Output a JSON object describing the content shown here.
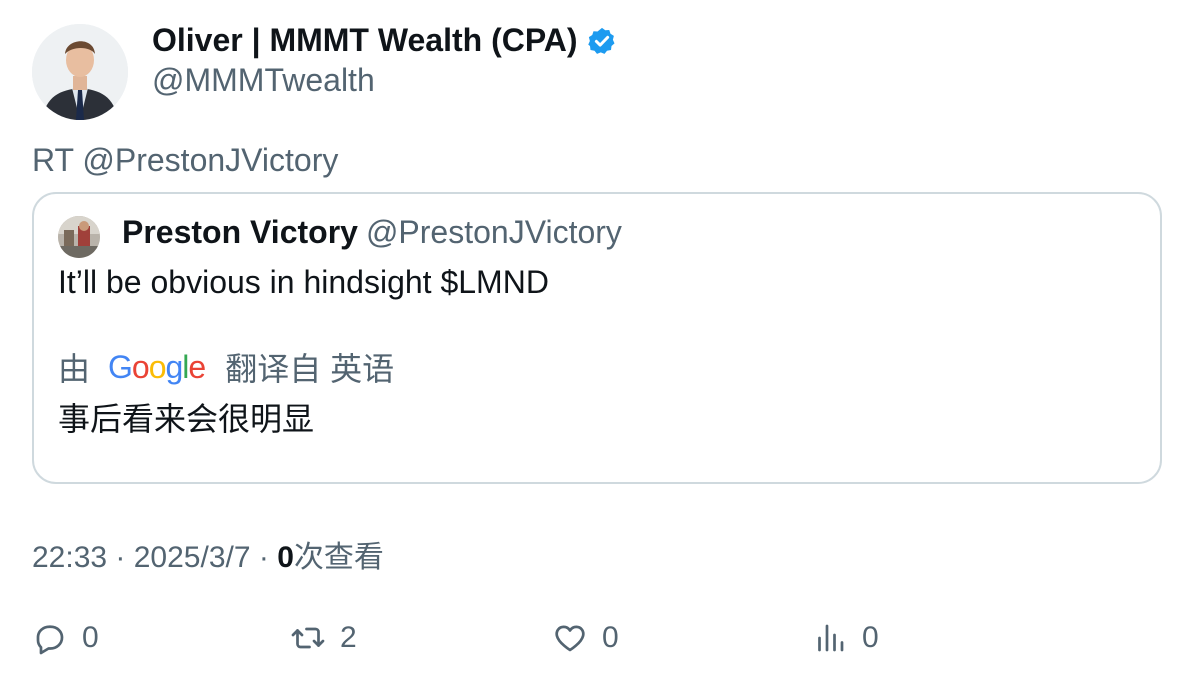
{
  "author": {
    "name": "Oliver | MMMT Wealth (CPA)",
    "handle": "@MMMTwealth",
    "verified_color": "#1d9bf0"
  },
  "retweet_text": "RT @PrestonJVictory",
  "quoted": {
    "name": "Preston Victory",
    "handle": "@PrestonJVictory",
    "text": "It’ll be obvious in hindsight $LMND",
    "translate_prefix": "由",
    "translate_logo": [
      "G",
      "o",
      "o",
      "g",
      "l",
      "e"
    ],
    "translate_suffix": "翻译自 英语",
    "translated_text": "事后看来会很明显"
  },
  "meta": {
    "time": "22:33",
    "date": "2025/3/7",
    "views_count": "0",
    "views_label": "次查看"
  },
  "actions": {
    "reply_count": "0",
    "retweet_count": "2",
    "like_count": "0",
    "views_count": "0"
  },
  "icons": {
    "reply": "reply-icon",
    "retweet": "retweet-icon",
    "like": "heart-icon",
    "views": "analytics-icon",
    "verified": "verified-badge-icon"
  }
}
